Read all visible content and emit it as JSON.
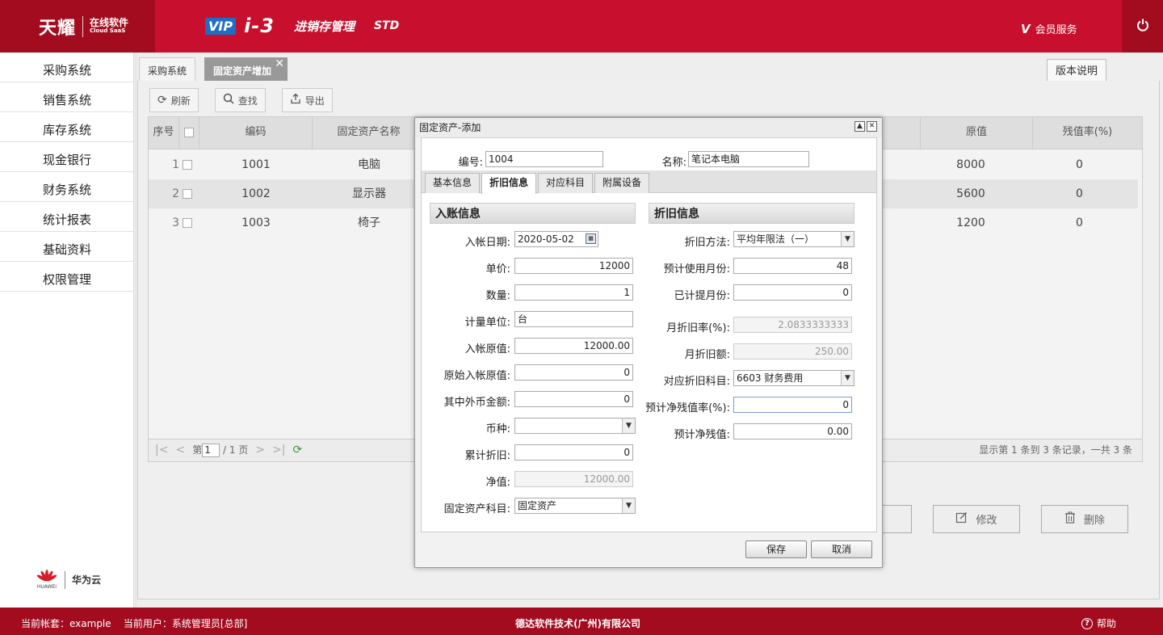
{
  "header": {
    "logo_main": "天耀",
    "logo_sub_cn": "在线软件",
    "logo_sub_en": "Cloud SaaS",
    "vip": "VIP",
    "product": "i-3",
    "product_name": "进销存管理",
    "edition": "STD",
    "member_v": "V",
    "member_label": "会员服务",
    "power_icon": "power-icon"
  },
  "sidebar": {
    "items": [
      {
        "label": "采购系统"
      },
      {
        "label": "销售系统"
      },
      {
        "label": "库存系统"
      },
      {
        "label": "现金银行"
      },
      {
        "label": "财务系统"
      },
      {
        "label": "统计报表"
      },
      {
        "label": "基础资料"
      },
      {
        "label": "权限管理"
      }
    ],
    "partner": "华为云",
    "partner_logo_text": "HUAWEI"
  },
  "tabs": {
    "items": [
      {
        "label": "采购系统"
      },
      {
        "label": "固定资产增加"
      }
    ],
    "close": "✕",
    "version_button": "版本说明"
  },
  "toolbar": {
    "refresh": "刷新",
    "search": "查找",
    "export": "导出"
  },
  "table": {
    "columns": [
      "序号",
      "编码",
      "固定资产名称",
      "原值",
      "残值率(%)"
    ],
    "rows": [
      {
        "no": "1",
        "code": "1001",
        "name": "电脑",
        "value": "8000",
        "rate": "0"
      },
      {
        "no": "2",
        "code": "1002",
        "name": "显示器",
        "value": "5600",
        "rate": "0"
      },
      {
        "no": "3",
        "code": "1003",
        "name": "椅子",
        "value": "1200",
        "rate": "0"
      }
    ]
  },
  "pager": {
    "page_prefix": "第",
    "page": "1",
    "page_suffix": "/ 1 页",
    "info": "显示第 1 条到 3 条记录，一共 3 条"
  },
  "actions": {
    "edit": "修改",
    "delete": "删除"
  },
  "dialog": {
    "title": "固定资产-添加",
    "code_label": "编号:",
    "code_value": "1004",
    "name_label": "名称:",
    "name_value": "笔记本电脑",
    "tabs": [
      "基本信息",
      "折旧信息",
      "对应科目",
      "附属设备"
    ],
    "left_section": "入账信息",
    "right_section": "折旧信息",
    "left_fields": [
      {
        "label": "入帐日期:",
        "value": "2020-05-02"
      },
      {
        "label": "单价:",
        "value": "12000"
      },
      {
        "label": "数量:",
        "value": "1"
      },
      {
        "label": "计量单位:",
        "value": "台"
      },
      {
        "label": "入帐原值:",
        "value": "12000.00"
      },
      {
        "label": "原始入帐原值:",
        "value": "0"
      },
      {
        "label": "其中外币金额:",
        "value": "0"
      },
      {
        "label": "币种:",
        "value": ""
      },
      {
        "label": "累计折旧:",
        "value": "0"
      },
      {
        "label": "净值:",
        "value": "12000.00"
      },
      {
        "label": "固定资产科目:",
        "value": "固定资产"
      }
    ],
    "right_fields": [
      {
        "label": "折旧方法:",
        "value": "平均年限法（一）"
      },
      {
        "label": "预计使用月份:",
        "value": "48"
      },
      {
        "label": "已计提月份:",
        "value": "0"
      },
      {
        "label": "月折旧率(%):",
        "value": "2.0833333333"
      },
      {
        "label": "月折旧额:",
        "value": "250.00"
      },
      {
        "label": "对应折旧科目:",
        "value": "6603  财务费用"
      },
      {
        "label": "预计净残值率(%):",
        "value": "0"
      },
      {
        "label": "预计净残值:",
        "value": "0.00"
      }
    ],
    "save": "保存",
    "cancel": "取消"
  },
  "footer": {
    "account": "当前帐套：example",
    "user": "当前用户：系统管理员[总部]",
    "company": "德达软件技术(广州)有限公司",
    "help": "帮助"
  }
}
